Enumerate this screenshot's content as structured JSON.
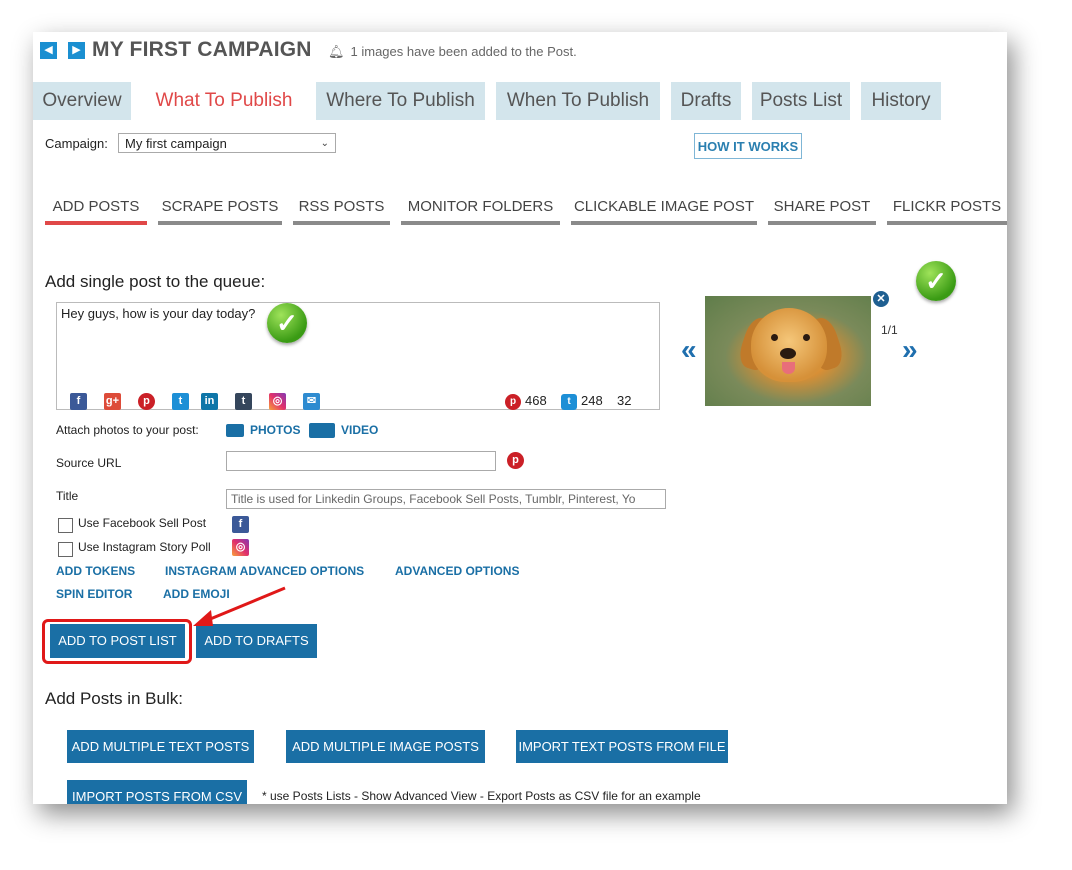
{
  "header": {
    "title": "MY FIRST CAMPAIGN",
    "notice": "1 images have been added to the Post.",
    "nav_prev": "◀",
    "nav_next": "▶"
  },
  "tabs": [
    {
      "label": "Overview",
      "active": false
    },
    {
      "label": "What To Publish",
      "active": true
    },
    {
      "label": "Where To Publish",
      "active": false
    },
    {
      "label": "When To Publish",
      "active": false
    },
    {
      "label": "Drafts",
      "active": false
    },
    {
      "label": "Posts List",
      "active": false
    },
    {
      "label": "History",
      "active": false
    }
  ],
  "campaign": {
    "label": "Campaign:",
    "selected": "My first campaign",
    "how_it_works": "HOW IT WORKS"
  },
  "subtabs": [
    {
      "label": "ADD POSTS",
      "active": true
    },
    {
      "label": "SCRAPE POSTS",
      "active": false
    },
    {
      "label": "RSS POSTS",
      "active": false
    },
    {
      "label": "MONITOR FOLDERS",
      "active": false
    },
    {
      "label": "CLICKABLE IMAGE POST",
      "active": false
    },
    {
      "label": "SHARE POST",
      "active": false
    },
    {
      "label": "FLICKR POSTS",
      "active": false
    }
  ],
  "composer": {
    "section_title": "Add single post to the queue:",
    "text": "Hey guys, how is your day today?",
    "social_icons": [
      "facebook-icon",
      "google-plus-icon",
      "pinterest-icon",
      "twitter-icon",
      "linkedin-icon",
      "tumblr-icon",
      "instagram-icon",
      "email-icon"
    ],
    "counters": {
      "pinterest": "468",
      "twitter": "248",
      "other": "32"
    }
  },
  "preview": {
    "pager": "1/1",
    "prev": "«",
    "next": "»"
  },
  "attach": {
    "label": "Attach photos to your post:",
    "photos": "PHOTOS",
    "video": "VIDEO"
  },
  "source_url": {
    "label": "Source URL",
    "value": ""
  },
  "title_field": {
    "label": "Title",
    "placeholder": "Title is used for Linkedin Groups, Facebook Sell Posts, Tumblr, Pinterest, Yo"
  },
  "options": {
    "facebook_sell": "Use Facebook Sell Post",
    "instagram_poll": "Use Instagram Story Poll"
  },
  "links": {
    "add_tokens": "ADD TOKENS",
    "instagram_advanced": "INSTAGRAM ADVANCED OPTIONS",
    "advanced": "ADVANCED OPTIONS",
    "spin_editor": "SPIN EDITOR",
    "add_emoji": "ADD EMOJI"
  },
  "actions": {
    "add_to_post_list": "ADD TO POST LIST",
    "add_to_drafts": "ADD TO DRAFTS"
  },
  "bulk": {
    "title": "Add Posts in Bulk:",
    "multiple_text": "ADD MULTIPLE TEXT POSTS",
    "multiple_image": "ADD MULTIPLE IMAGE POSTS",
    "import_text": "IMPORT TEXT POSTS FROM FILE",
    "import_csv": "IMPORT POSTS FROM CSV",
    "note": "* use Posts Lists - Show Advanced View - Export Posts as CSV file for an example"
  },
  "colors": {
    "accent_blue": "#1a6fa5",
    "active_tab_red": "#e04848",
    "tab_bg": "#d3e5ec",
    "highlight_red": "#e01818"
  }
}
